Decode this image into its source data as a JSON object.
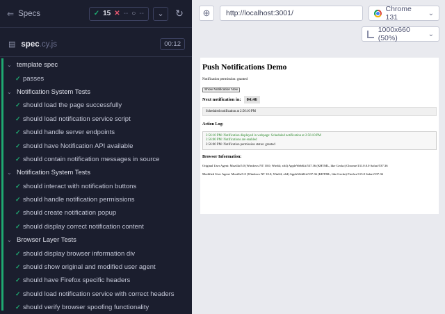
{
  "runner": {
    "specs_label": "Specs",
    "passed_count": "15",
    "failed_count": "--",
    "pending_count": "--",
    "spec_file": {
      "name": "spec",
      "ext": ".cy.js",
      "duration": "00:12"
    },
    "suites": [
      {
        "title": "template spec",
        "tests": [
          "passes"
        ]
      },
      {
        "title": "Notification System Tests",
        "tests": [
          "should load the page successfully",
          "should load notification service script",
          "should handle server endpoints",
          "should have Notification API available",
          "should contain notification messages in source"
        ]
      },
      {
        "title": "Notification System Tests",
        "tests": [
          "should interact with notification buttons",
          "should handle notification permissions",
          "should create notification popup",
          "should display correct notification content"
        ]
      },
      {
        "title": "Browser Layer Tests",
        "tests": [
          "should display browser information div",
          "should show original and modified user agent",
          "should have Firefox specific headers",
          "should load notification service with correct headers",
          "should verify browser spoofing functionality"
        ]
      }
    ]
  },
  "browser_bar": {
    "url": "http://localhost:3001/",
    "browser": "Chrome 131",
    "viewport": "1000x660 (50%)"
  },
  "app": {
    "title": "Push Notifications Demo",
    "permission_text": "Notification permission: granted",
    "show_button": "Show Notification Now",
    "next_label": "Next notification in:",
    "timer": "04:46",
    "scheduled_text": "Scheduled notification at 2:56:10 PM",
    "action_log_heading": "Action Log:",
    "log": [
      {
        "text": "2:56:10 PM: Notification displayed in webpage: Scheduled notification at 2:56:10 PM",
        "color": "green"
      },
      {
        "text": "2:56:00 PM: Notifications are enabled",
        "color": "green"
      },
      {
        "text": "2:56:00 PM: Notification permission status: granted",
        "color": "black"
      }
    ],
    "browser_info_heading": "Browser Information:",
    "original_ua": "Original User Agent: Mozilla/5.0 (Windows NT 10.0; Win64; x64) AppleWebKit/537.36 (KHTML, like Gecko) Chrome/131.0.0.0 Safari/537.36",
    "modified_ua": "Modified User Agent: Mozilla/5.0 (Windows NT 10.0; Win64; x64) AppleWebKit/537.36 (KHTML, like Gecko) Firefox/115.0 Safari/537.36"
  },
  "colors": {
    "pass": "#1fa971",
    "fail": "#e45770",
    "panel_bg": "#1b1e2e",
    "preview_bg": "#e9eaef"
  }
}
